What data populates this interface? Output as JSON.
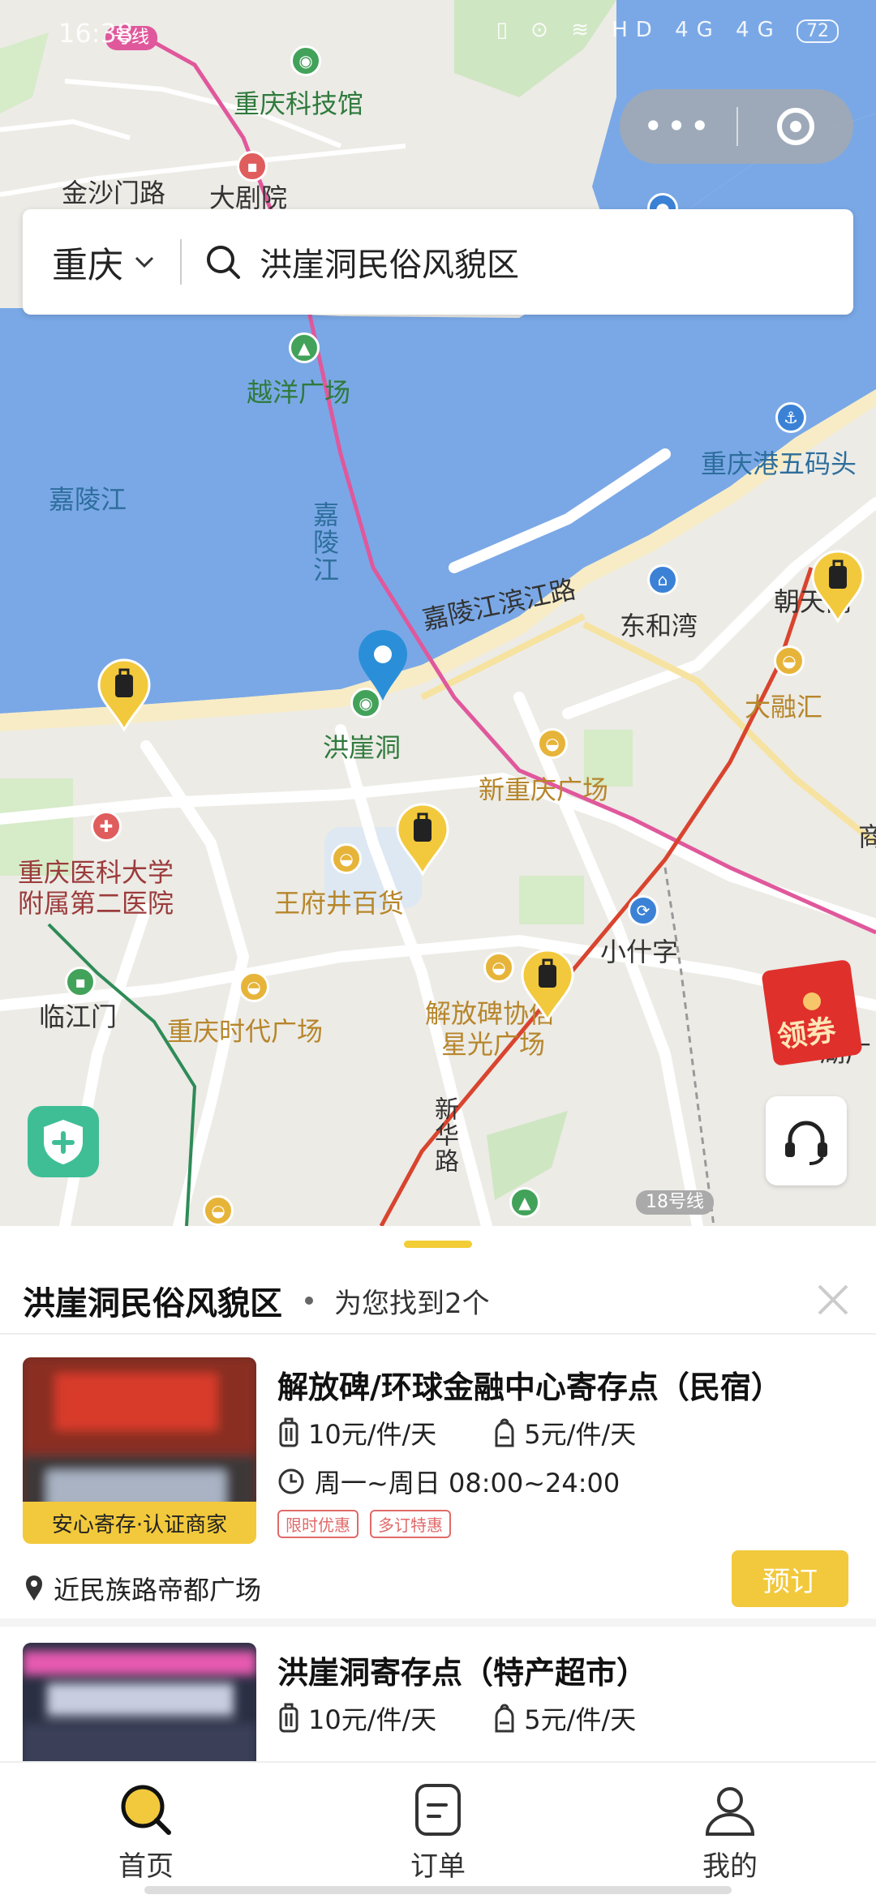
{
  "statusbar": {
    "time": "16:38",
    "icons": "▯ ⊙ ≋ HD 4G 4G",
    "battery": "72"
  },
  "capsule": {
    "more": "•••"
  },
  "search": {
    "city": "重庆",
    "query": "洪崖洞民俗风貌区"
  },
  "map": {
    "labels": {
      "museum": "重庆科技馆",
      "jinsha": "金沙门路",
      "theatre": "大剧院",
      "yueyang": "越洋广场",
      "jialingjiang": "嘉陵江",
      "jialingjiang_vertical": "嘉陵江",
      "port": "重庆港五码头",
      "riverside_road": "嘉陵江滨江路",
      "donghewan": "东和湾",
      "chaotianmen": "朝天门",
      "darongh": "大融汇",
      "hongyadong": "洪崖洞",
      "new_plaza": "新重庆广场",
      "hospital_line1": "重庆医科大学",
      "hospital_line2": "附属第二医院",
      "wangfujing": "王府井百货",
      "xiaoshizi": "小什字",
      "linjiangmen": "临江门",
      "times_square": "重庆时代广场",
      "jfb_line1": "解放碑协信",
      "jfb_line2": "星光广场",
      "xinhua": "新华路",
      "line18": "18号线",
      "metro_tag": "号线",
      "right_edge_1": "商",
      "right_edge_2": "湖广"
    }
  },
  "coupon": {
    "label": "领券"
  },
  "sheet": {
    "title": "洪崖洞民俗风貌区",
    "found": "为您找到2个",
    "cards": [
      {
        "name": "解放碑/环球金融中心寄存点（民宿）",
        "price_luggage": "10元/件/天",
        "price_bag": "5元/件/天",
        "hours": "周一~周日 08:00~24:00",
        "tags": [
          "限时优惠",
          "多订特惠"
        ],
        "badge": "安心寄存·认证商家",
        "address": "近民族路帝都广场",
        "book": "预订"
      },
      {
        "name": "洪崖洞寄存点（特产超市）",
        "price_luggage": "10元/件/天",
        "price_bag": "5元/件/天"
      }
    ]
  },
  "tabs": [
    {
      "label": "首页",
      "active": true
    },
    {
      "label": "订单",
      "active": false
    },
    {
      "label": "我的",
      "active": false
    }
  ],
  "colors": {
    "accent": "#f2c93c",
    "river": "#7aa8e6",
    "metro_pink": "#e0589c",
    "metro_red": "#d9442e"
  }
}
